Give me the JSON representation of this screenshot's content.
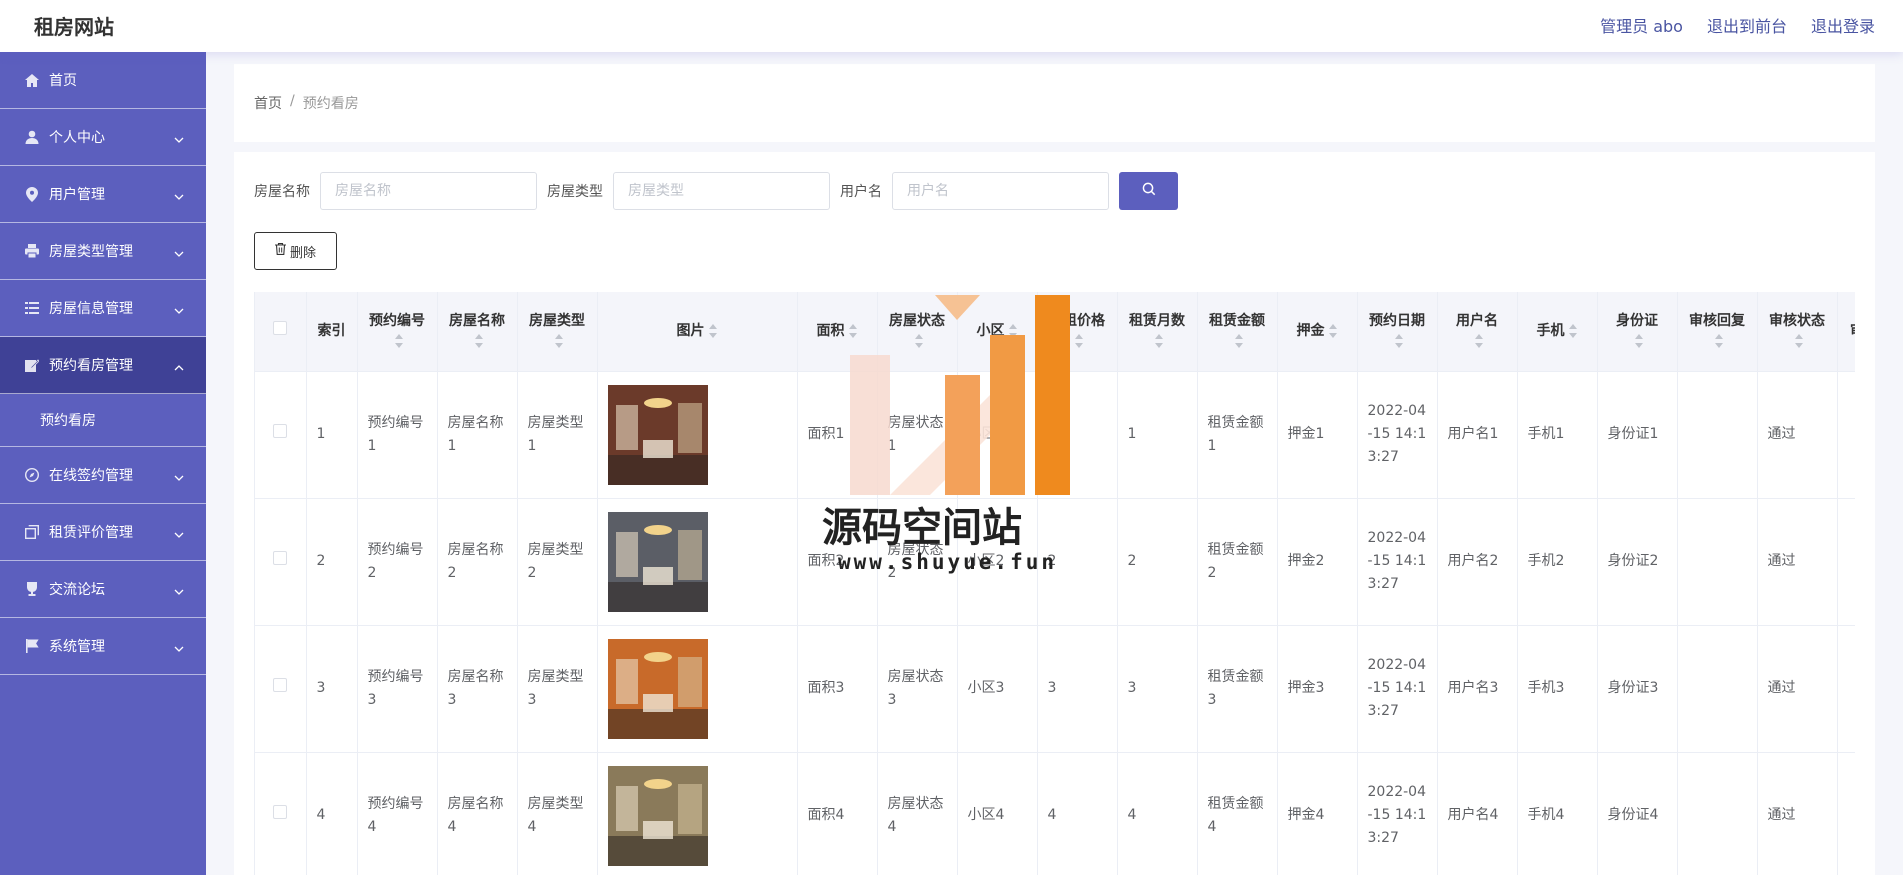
{
  "header": {
    "brand": "租房网站",
    "admin": "管理员 abo",
    "to_front": "退出到前台",
    "logout": "退出登录"
  },
  "sidebar": {
    "items": [
      {
        "label": "首页",
        "icon": "home-icon",
        "has_children": false
      },
      {
        "label": "个人中心",
        "icon": "user-icon",
        "has_children": true
      },
      {
        "label": "用户管理",
        "icon": "location-icon",
        "has_children": true
      },
      {
        "label": "房屋类型管理",
        "icon": "printer-icon",
        "has_children": true
      },
      {
        "label": "房屋信息管理",
        "icon": "list-icon",
        "has_children": true
      },
      {
        "label": "预约看房管理",
        "icon": "edit-icon",
        "has_children": true,
        "active": true
      },
      {
        "label": "在线签约管理",
        "icon": "compass-icon",
        "has_children": true
      },
      {
        "label": "租赁评价管理",
        "icon": "copy-icon",
        "has_children": true
      },
      {
        "label": "交流论坛",
        "icon": "trophy-icon",
        "has_children": true
      },
      {
        "label": "系统管理",
        "icon": "flag-icon",
        "has_children": true
      }
    ],
    "submenu": "预约看房"
  },
  "breadcrumb": {
    "home": "首页",
    "sep": "/",
    "current": "预约看房"
  },
  "search": {
    "house_name_label": "房屋名称",
    "house_name_placeholder": "房屋名称",
    "house_type_label": "房屋类型",
    "house_type_placeholder": "房屋类型",
    "username_label": "用户名",
    "username_placeholder": "用户名"
  },
  "delete_label": "删除",
  "table": {
    "headers": [
      "索引",
      "预约编号",
      "房屋名称",
      "房屋类型",
      "图片",
      "面积",
      "房屋状态",
      "小区",
      "月租价格",
      "租赁月数",
      "租赁金额",
      "押金",
      "预约日期",
      "用户名",
      "手机",
      "身份证",
      "审核回复",
      "审核状态",
      "审"
    ],
    "rows": [
      {
        "index": "1",
        "code": "预约编号1",
        "name": "房屋名称1",
        "type": "房屋类型1",
        "area": "面积1",
        "status": "房屋状态1",
        "community": "小区1",
        "price": "1",
        "months": "1",
        "amount": "租赁金额1",
        "deposit": "押金1",
        "date": "2022-04-15 14:13:27",
        "user": "用户名1",
        "phone": "手机1",
        "idcard": "身份证1",
        "reply": "",
        "audit": "通过",
        "photo_tint": "#6b3a2a"
      },
      {
        "index": "2",
        "code": "预约编号2",
        "name": "房屋名称2",
        "type": "房屋类型2",
        "area": "面积2",
        "status": "房屋状态2",
        "community": "小区2",
        "price": "2",
        "months": "2",
        "amount": "租赁金额2",
        "deposit": "押金2",
        "date": "2022-04-15 14:13:27",
        "user": "用户名2",
        "phone": "手机2",
        "idcard": "身份证2",
        "reply": "",
        "audit": "通过",
        "photo_tint": "#5b5e66"
      },
      {
        "index": "3",
        "code": "预约编号3",
        "name": "房屋名称3",
        "type": "房屋类型3",
        "area": "面积3",
        "status": "房屋状态3",
        "community": "小区3",
        "price": "3",
        "months": "3",
        "amount": "租赁金额3",
        "deposit": "押金3",
        "date": "2022-04-15 14:13:27",
        "user": "用户名3",
        "phone": "手机3",
        "idcard": "身份证3",
        "reply": "",
        "audit": "通过",
        "photo_tint": "#c86a2a"
      },
      {
        "index": "4",
        "code": "预约编号4",
        "name": "房屋名称4",
        "type": "房屋类型4",
        "area": "面积4",
        "status": "房屋状态4",
        "community": "小区4",
        "price": "4",
        "months": "4",
        "amount": "租赁金额4",
        "deposit": "押金4",
        "date": "2022-04-15 14:13:27",
        "user": "用户名4",
        "phone": "手机4",
        "idcard": "身份证4",
        "reply": "",
        "audit": "通过",
        "photo_tint": "#8a7a5a"
      }
    ]
  },
  "watermark": {
    "text": "源码空间站",
    "url": "www.shuyue.fun"
  },
  "colors": {
    "sidebar": "#5c5fbe",
    "sidebar_active": "#3f4196",
    "accent": "#4a55a2"
  }
}
